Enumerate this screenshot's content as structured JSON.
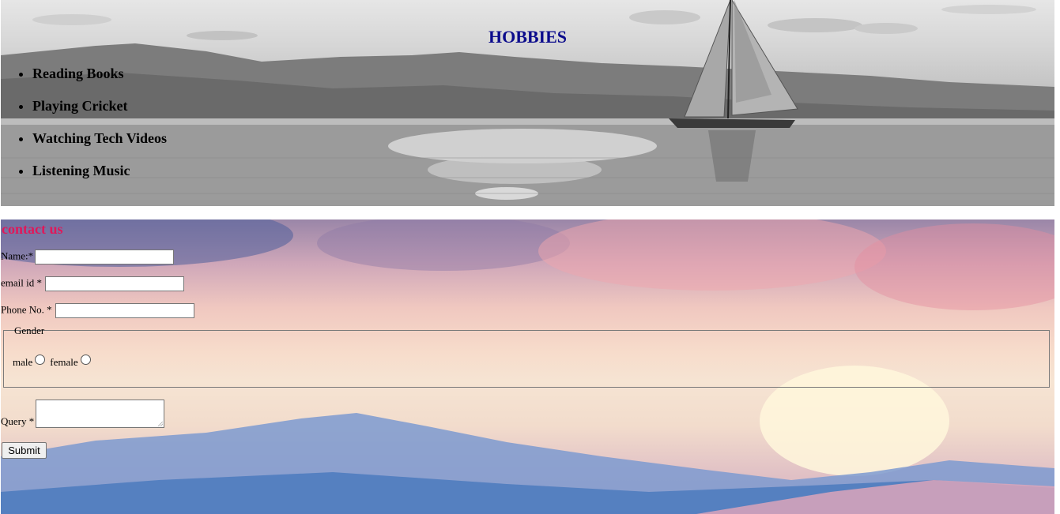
{
  "hobbies": {
    "title": "HOBBIES",
    "items": [
      {
        "label": "Reading Books"
      },
      {
        "label": "Playing Cricket"
      },
      {
        "label": "Watching Tech Videos"
      },
      {
        "label": "Listening Music"
      }
    ]
  },
  "contact": {
    "title": "contact us",
    "fields": {
      "name_label": "Name:*",
      "email_label": "email id *",
      "phone_label": "Phone No. *",
      "name_value": "",
      "email_value": "",
      "phone_value": ""
    },
    "gender": {
      "legend": "Gender",
      "options": [
        "male",
        "female"
      ]
    },
    "query_label": "Query *",
    "submit_label": "Submit"
  },
  "colors": {
    "hobbies_title": "#0b0b8c",
    "contact_title": "#e0185a"
  }
}
